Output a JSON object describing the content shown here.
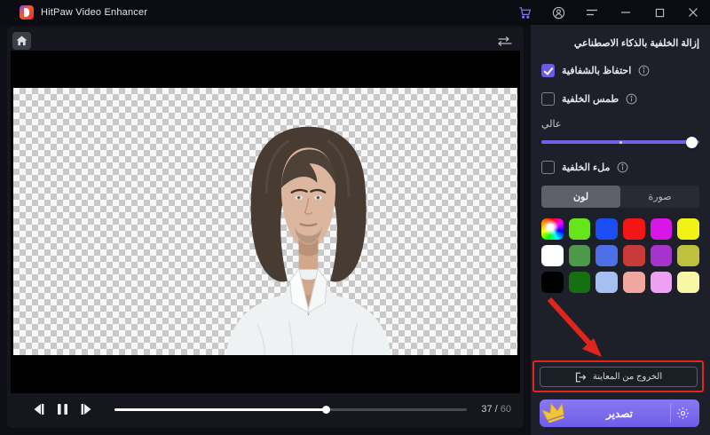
{
  "titlebar": {
    "app_title": "HitPaw Video Enhancer",
    "icons": [
      "cart-icon",
      "account-icon",
      "menu-icon",
      "minimize-icon",
      "maximize-icon",
      "close-icon"
    ]
  },
  "preview": {
    "icons": [
      "home-icon",
      "compare-icon"
    ]
  },
  "playback": {
    "progress_percent": 60,
    "frame_current": "37",
    "frame_separator": " / ",
    "frame_total": "60",
    "icons": [
      "previous-frame-icon",
      "pause-icon",
      "next-frame-icon"
    ]
  },
  "sidebar": {
    "title": "إزالة الخلفية بالذكاء الاصطناعي",
    "keep_transparency": {
      "label": "احتفاظ بالشفافية",
      "checked": true
    },
    "blur_background": {
      "label": "طمس الخلفية",
      "checked": false
    },
    "blur_level": {
      "label": "عالي",
      "value_percent": 97
    },
    "fill_background": {
      "label": "ملء الخلفية",
      "checked": false
    },
    "tabs": {
      "color_label": "لون",
      "image_label": "صورة",
      "active": "لون"
    },
    "swatches": [
      "rainbow",
      "#66e61a",
      "#1a4df2",
      "#f21616",
      "#d916e8",
      "#f2f216",
      "#ffffff",
      "#4d9949",
      "#4d70e6",
      "#c93b38",
      "#a633cc",
      "#bfbf40",
      "#000000",
      "#157010",
      "#a6bff2",
      "#f2a6a0",
      "#efa0f2",
      "#f7f7a6"
    ],
    "exit_preview_label": "الخروج من المعاينة",
    "export_label": "تصدير"
  },
  "colors": {
    "accent_purple": "#6f5de9",
    "annotation_red": "#e0261c",
    "sidebar_bg": "#1e2029",
    "panel_bg": "#16171e"
  }
}
